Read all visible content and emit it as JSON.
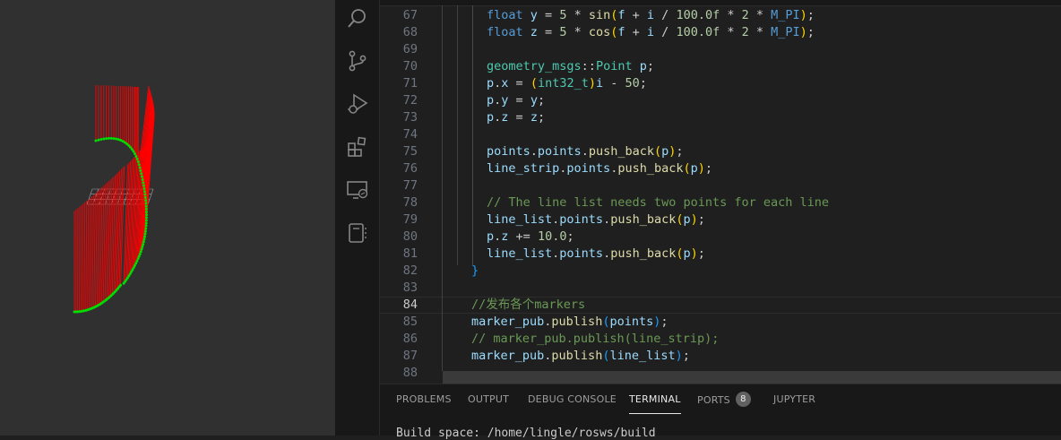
{
  "activity_bar": {
    "icons": [
      "search-icon",
      "source-control-icon",
      "run-debug-icon",
      "extensions-icon",
      "remote-explorer-icon",
      "notebook-icon"
    ]
  },
  "editor": {
    "current_line": 84,
    "lines": [
      {
        "no": "67",
        "indent": 3,
        "tokens": [
          [
            "float",
            "kw"
          ],
          [
            " ",
            "pun"
          ],
          [
            "y",
            "var"
          ],
          [
            " = ",
            "pun"
          ],
          [
            "5",
            "num"
          ],
          [
            " * ",
            "pun"
          ],
          [
            "sin",
            "fn"
          ],
          [
            "(",
            "br1"
          ],
          [
            "f",
            "var"
          ],
          [
            " + ",
            "pun"
          ],
          [
            "i",
            "var"
          ],
          [
            " / ",
            "pun"
          ],
          [
            "100.0f",
            "num"
          ],
          [
            " * ",
            "pun"
          ],
          [
            "2",
            "num"
          ],
          [
            " * ",
            "pun"
          ],
          [
            "M_PI",
            "mac"
          ],
          [
            ")",
            "br1"
          ],
          [
            ";",
            "pun"
          ]
        ]
      },
      {
        "no": "68",
        "indent": 3,
        "tokens": [
          [
            "float",
            "kw"
          ],
          [
            " ",
            "pun"
          ],
          [
            "z",
            "var"
          ],
          [
            " = ",
            "pun"
          ],
          [
            "5",
            "num"
          ],
          [
            " * ",
            "pun"
          ],
          [
            "cos",
            "fn"
          ],
          [
            "(",
            "br1"
          ],
          [
            "f",
            "var"
          ],
          [
            " + ",
            "pun"
          ],
          [
            "i",
            "var"
          ],
          [
            " / ",
            "pun"
          ],
          [
            "100.0f",
            "num"
          ],
          [
            " * ",
            "pun"
          ],
          [
            "2",
            "num"
          ],
          [
            " * ",
            "pun"
          ],
          [
            "M_PI",
            "mac"
          ],
          [
            ")",
            "br1"
          ],
          [
            ";",
            "pun"
          ]
        ]
      },
      {
        "no": "69",
        "indent": 3,
        "tokens": []
      },
      {
        "no": "70",
        "indent": 3,
        "tokens": [
          [
            "geometry_msgs",
            "ty"
          ],
          [
            "::",
            "pun"
          ],
          [
            "Point",
            "ty"
          ],
          [
            " ",
            "pun"
          ],
          [
            "p",
            "var"
          ],
          [
            ";",
            "pun"
          ]
        ]
      },
      {
        "no": "71",
        "indent": 3,
        "tokens": [
          [
            "p",
            "var"
          ],
          [
            ".",
            "pun"
          ],
          [
            "x",
            "var"
          ],
          [
            " = ",
            "pun"
          ],
          [
            "(",
            "br1"
          ],
          [
            "int32_t",
            "ty"
          ],
          [
            ")",
            "br1"
          ],
          [
            "i",
            "var"
          ],
          [
            " - ",
            "pun"
          ],
          [
            "50",
            "num"
          ],
          [
            ";",
            "pun"
          ]
        ]
      },
      {
        "no": "72",
        "indent": 3,
        "tokens": [
          [
            "p",
            "var"
          ],
          [
            ".",
            "pun"
          ],
          [
            "y",
            "var"
          ],
          [
            " = ",
            "pun"
          ],
          [
            "y",
            "var"
          ],
          [
            ";",
            "pun"
          ]
        ]
      },
      {
        "no": "73",
        "indent": 3,
        "tokens": [
          [
            "p",
            "var"
          ],
          [
            ".",
            "pun"
          ],
          [
            "z",
            "var"
          ],
          [
            " = ",
            "pun"
          ],
          [
            "z",
            "var"
          ],
          [
            ";",
            "pun"
          ]
        ]
      },
      {
        "no": "74",
        "indent": 3,
        "tokens": []
      },
      {
        "no": "75",
        "indent": 3,
        "tokens": [
          [
            "points",
            "var"
          ],
          [
            ".",
            "pun"
          ],
          [
            "points",
            "var"
          ],
          [
            ".",
            "pun"
          ],
          [
            "push_back",
            "fn"
          ],
          [
            "(",
            "br1"
          ],
          [
            "p",
            "var"
          ],
          [
            ")",
            "br1"
          ],
          [
            ";",
            "pun"
          ]
        ]
      },
      {
        "no": "76",
        "indent": 3,
        "tokens": [
          [
            "line_strip",
            "var"
          ],
          [
            ".",
            "pun"
          ],
          [
            "points",
            "var"
          ],
          [
            ".",
            "pun"
          ],
          [
            "push_back",
            "fn"
          ],
          [
            "(",
            "br1"
          ],
          [
            "p",
            "var"
          ],
          [
            ")",
            "br1"
          ],
          [
            ";",
            "pun"
          ]
        ]
      },
      {
        "no": "77",
        "indent": 3,
        "tokens": []
      },
      {
        "no": "78",
        "indent": 3,
        "tokens": [
          [
            "// The line list needs two points for each line",
            "cmt"
          ]
        ]
      },
      {
        "no": "79",
        "indent": 3,
        "tokens": [
          [
            "line_list",
            "var"
          ],
          [
            ".",
            "pun"
          ],
          [
            "points",
            "var"
          ],
          [
            ".",
            "pun"
          ],
          [
            "push_back",
            "fn"
          ],
          [
            "(",
            "br1"
          ],
          [
            "p",
            "var"
          ],
          [
            ")",
            "br1"
          ],
          [
            ";",
            "pun"
          ]
        ]
      },
      {
        "no": "80",
        "indent": 3,
        "tokens": [
          [
            "p",
            "var"
          ],
          [
            ".",
            "pun"
          ],
          [
            "z",
            "var"
          ],
          [
            " += ",
            "pun"
          ],
          [
            "10.0",
            "num"
          ],
          [
            ";",
            "pun"
          ]
        ]
      },
      {
        "no": "81",
        "indent": 3,
        "tokens": [
          [
            "line_list",
            "var"
          ],
          [
            ".",
            "pun"
          ],
          [
            "points",
            "var"
          ],
          [
            ".",
            "pun"
          ],
          [
            "push_back",
            "fn"
          ],
          [
            "(",
            "br1"
          ],
          [
            "p",
            "var"
          ],
          [
            ")",
            "br1"
          ],
          [
            ";",
            "pun"
          ]
        ]
      },
      {
        "no": "82",
        "indent": 2,
        "tokens": [
          [
            "}",
            "br3"
          ]
        ]
      },
      {
        "no": "83",
        "indent": 2,
        "tokens": []
      },
      {
        "no": "84",
        "indent": 2,
        "tokens": [
          [
            "//发布各个markers",
            "cmt"
          ]
        ]
      },
      {
        "no": "85",
        "indent": 2,
        "tokens": [
          [
            "marker_pub",
            "var"
          ],
          [
            ".",
            "pun"
          ],
          [
            "publish",
            "fn"
          ],
          [
            "(",
            "br3"
          ],
          [
            "points",
            "var"
          ],
          [
            ")",
            "br3"
          ],
          [
            ";",
            "pun"
          ]
        ]
      },
      {
        "no": "86",
        "indent": 2,
        "tokens": [
          [
            "// marker_pub.publish(line_strip);",
            "cmt"
          ]
        ]
      },
      {
        "no": "87",
        "indent": 2,
        "tokens": [
          [
            "marker_pub",
            "var"
          ],
          [
            ".",
            "pun"
          ],
          [
            "publish",
            "fn"
          ],
          [
            "(",
            "br3"
          ],
          [
            "line_list",
            "var"
          ],
          [
            ")",
            "br3"
          ],
          [
            ";",
            "pun"
          ]
        ]
      },
      {
        "no": "88",
        "indent": 2,
        "tokens": []
      }
    ]
  },
  "panel": {
    "tabs": [
      {
        "label": "PROBLEMS",
        "active": false
      },
      {
        "label": "OUTPUT",
        "active": false
      },
      {
        "label": "DEBUG CONSOLE",
        "active": false
      },
      {
        "label": "TERMINAL",
        "active": true
      },
      {
        "label": "PORTS",
        "active": false,
        "badge": "8"
      },
      {
        "label": "JUPYTER",
        "active": false
      }
    ],
    "terminal_text": "Build space: /home/lingle/rosws/build"
  },
  "colors": {
    "viz_background": "#303030",
    "spring_lines": "#ff0000",
    "points": "#00dd00",
    "grid": "#a0a0a0"
  }
}
